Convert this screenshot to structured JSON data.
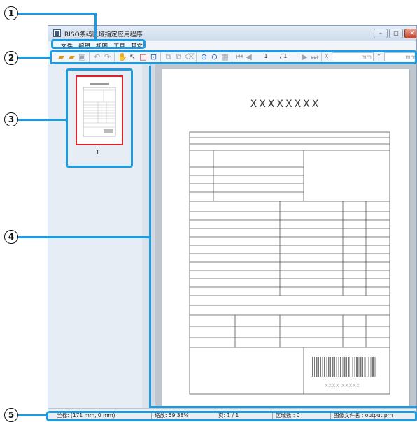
{
  "window": {
    "title": "RISO条码区域指定应用程序",
    "minimize_label": "–",
    "maximize_label": "▢",
    "close_label": "✕"
  },
  "menu": {
    "items": [
      "文件",
      "编辑",
      "视图",
      "工具",
      "其它"
    ]
  },
  "toolbar": {
    "page_current": "1",
    "page_total": "/ 1",
    "x_label": "X",
    "x_unit": "mm",
    "y_label": "Y",
    "y_unit": "mm"
  },
  "thumbnail": {
    "page_number": "1"
  },
  "document": {
    "heading": "XXXXXXXX",
    "barcode_text": "XXXX XXXXX"
  },
  "status": {
    "coordinates": "坐标: (171 mm, 0 mm)",
    "zoom": "缩放: 59.38%",
    "page": "页: 1 / 1",
    "area_count": "区域数 : 0",
    "image_file": "图像文件名 : output.prn"
  },
  "callouts": [
    "1",
    "2",
    "3",
    "4",
    "5"
  ],
  "colors": {
    "callout_line": "#1e9be0",
    "thumbnail_border": "#d8232a"
  }
}
